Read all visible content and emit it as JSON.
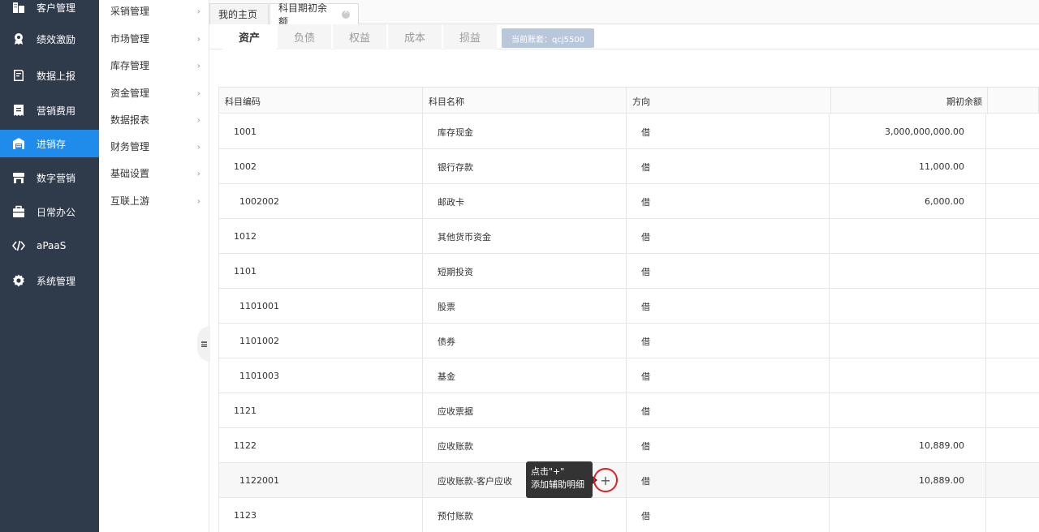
{
  "sidebar": {
    "items": [
      {
        "label": "客户管理",
        "icon": "building-icon",
        "active": false
      },
      {
        "label": "绩效激励",
        "icon": "medal-icon",
        "active": false
      },
      {
        "label": "数据上报",
        "icon": "report-icon",
        "active": false
      },
      {
        "label": "营销费用",
        "icon": "receipt-icon",
        "active": false
      },
      {
        "label": "进销存",
        "icon": "warehouse-icon",
        "active": true
      },
      {
        "label": "数字营销",
        "icon": "store-icon",
        "active": false
      },
      {
        "label": "日常办公",
        "icon": "briefcase-icon",
        "active": false
      },
      {
        "label": "aPaaS",
        "icon": "code-icon",
        "active": false
      },
      {
        "label": "系统管理",
        "icon": "gear-icon",
        "active": false
      }
    ]
  },
  "submenu": {
    "items": [
      {
        "label": "采销管理"
      },
      {
        "label": "市场管理"
      },
      {
        "label": "库存管理"
      },
      {
        "label": "资金管理"
      },
      {
        "label": "数据报表"
      },
      {
        "label": "财务管理"
      },
      {
        "label": "基础设置"
      },
      {
        "label": "互联上游"
      }
    ],
    "arrow": "›"
  },
  "page_tabs": [
    {
      "label": "我的主页"
    },
    {
      "label": "科目期初余额"
    }
  ],
  "sub_tabs": [
    {
      "label": "资产"
    },
    {
      "label": "负债"
    },
    {
      "label": "权益"
    },
    {
      "label": "成本"
    },
    {
      "label": "损益"
    }
  ],
  "account_badge": "当前账套：qcj5500",
  "table": {
    "headers": [
      "科目编码",
      "科目名称",
      "方向",
      "期初余额"
    ],
    "rows": [
      {
        "code": "1001",
        "name": "库存现金",
        "direction": "借",
        "balance": "3,000,000,000.00"
      },
      {
        "code": "1002",
        "name": "银行存款",
        "direction": "借",
        "balance": "11,000.00"
      },
      {
        "code": "1002002",
        "name": "邮政卡",
        "direction": "借",
        "balance": "6,000.00"
      },
      {
        "code": "1012",
        "name": "其他货币资金",
        "direction": "借",
        "balance": ""
      },
      {
        "code": "1101",
        "name": "短期投资",
        "direction": "借",
        "balance": ""
      },
      {
        "code": "1101001",
        "name": "股票",
        "direction": "借",
        "balance": ""
      },
      {
        "code": "1101002",
        "name": "债券",
        "direction": "借",
        "balance": ""
      },
      {
        "code": "1101003",
        "name": "基金",
        "direction": "借",
        "balance": ""
      },
      {
        "code": "1121",
        "name": "应收票据",
        "direction": "借",
        "balance": ""
      },
      {
        "code": "1122",
        "name": "应收账款",
        "direction": "借",
        "balance": "10,889.00"
      },
      {
        "code": "1122001",
        "name": "应收账款-客户应收",
        "direction": "借",
        "balance": "10,889.00"
      },
      {
        "code": "1123",
        "name": "预付账款",
        "direction": "借",
        "balance": ""
      }
    ]
  },
  "tooltip": {
    "line1": "点击\"+\"",
    "line2": "添加辅助明细"
  },
  "add_button": "+"
}
